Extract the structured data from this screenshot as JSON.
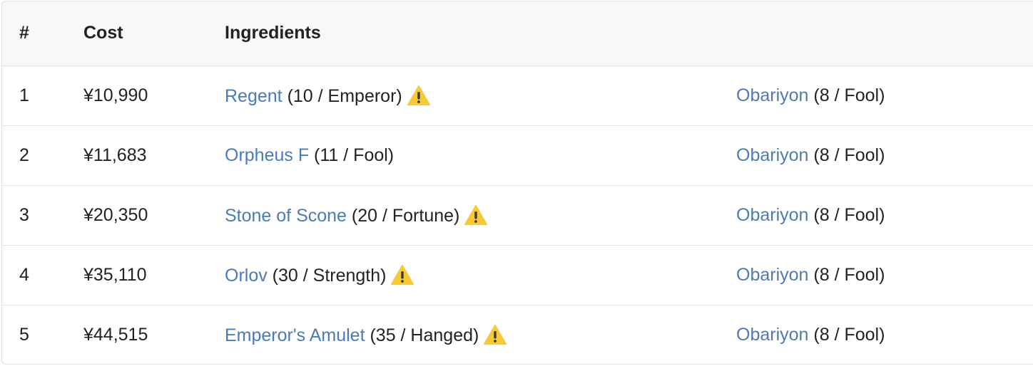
{
  "header": {
    "index": "#",
    "cost": "Cost",
    "ingredients": "Ingredients"
  },
  "rows": [
    {
      "index": "1",
      "cost": "¥10,990",
      "ingredient1": {
        "name": "Regent",
        "detail": " (10 / Emperor)",
        "warning": true
      },
      "ingredient2": {
        "name": "Obariyon",
        "detail": " (8 / Fool)"
      }
    },
    {
      "index": "2",
      "cost": "¥11,683",
      "ingredient1": {
        "name": "Orpheus F",
        "detail": " (11 / Fool)",
        "warning": false
      },
      "ingredient2": {
        "name": "Obariyon",
        "detail": " (8 / Fool)"
      }
    },
    {
      "index": "3",
      "cost": "¥20,350",
      "ingredient1": {
        "name": "Stone of Scone",
        "detail": " (20 / Fortune)",
        "warning": true
      },
      "ingredient2": {
        "name": "Obariyon",
        "detail": " (8 / Fool)"
      }
    },
    {
      "index": "4",
      "cost": "¥35,110",
      "ingredient1": {
        "name": "Orlov",
        "detail": " (30 / Strength)",
        "warning": true
      },
      "ingredient2": {
        "name": "Obariyon",
        "detail": " (8 / Fool)"
      }
    },
    {
      "index": "5",
      "cost": "¥44,515",
      "ingredient1": {
        "name": "Emperor's Amulet",
        "detail": " (35 / Hanged)",
        "warning": true
      },
      "ingredient2": {
        "name": "Obariyon",
        "detail": " (8 / Fool)"
      }
    }
  ],
  "icons": {
    "warning": "warning-icon"
  },
  "colors": {
    "link": "#4a7bb7",
    "warning_fill": "#f7c935",
    "header_bg": "#f7f8f9"
  }
}
